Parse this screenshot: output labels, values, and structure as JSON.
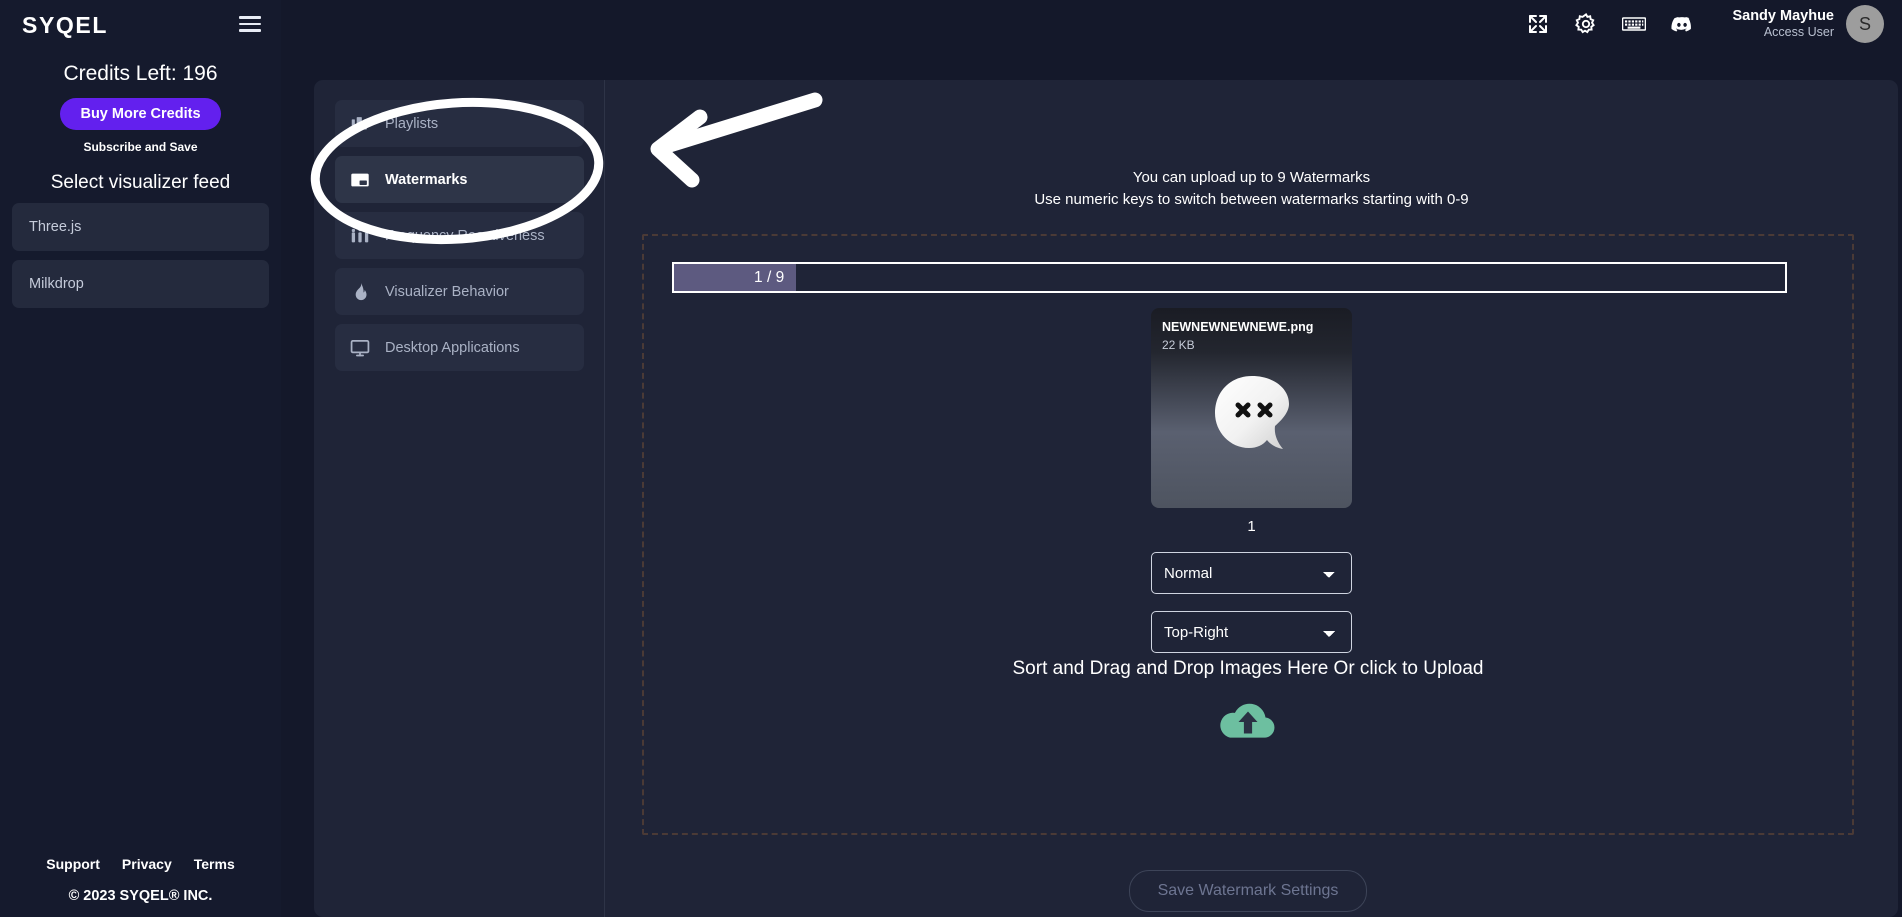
{
  "brand": {
    "logo_text": "SYQEL",
    "menu_icon": "hamburger-menu-icon"
  },
  "sidebar": {
    "credits_label": "Credits Left: 196",
    "buy_credits_label": "Buy More Credits",
    "subscribe_label": "Subscribe and Save",
    "feed_section_title": "Select visualizer feed",
    "feeds": [
      {
        "label": "Three.js"
      },
      {
        "label": "Milkdrop"
      }
    ],
    "footer": {
      "links": [
        "Support",
        "Privacy",
        "Terms"
      ],
      "copyright": "© 2023 SYQEL® INC."
    }
  },
  "topbar": {
    "icons": [
      {
        "name": "fullscreen-expand-icon"
      },
      {
        "name": "gear-icon"
      },
      {
        "name": "keyboard-icon"
      },
      {
        "name": "discord-icon"
      }
    ],
    "user_name": "Sandy Mayhue",
    "user_role": "Access User",
    "avatar_initial": "S"
  },
  "nav": {
    "items": [
      {
        "label": "Playlists",
        "icon": "playlists-bars-icon",
        "active": false
      },
      {
        "label": "Watermarks",
        "icon": "watermark-frame-icon",
        "active": true
      },
      {
        "label": "Frequency Reactiveness",
        "icon": "equalizer-icon",
        "active": false
      },
      {
        "label": "Visualizer Behavior",
        "icon": "flame-icon",
        "active": false
      },
      {
        "label": "Desktop Applications",
        "icon": "monitor-icon",
        "active": false
      }
    ]
  },
  "main": {
    "info_line_1": "You can upload up to 9 Watermarks",
    "info_line_2": "Use numeric keys to switch between watermarks starting with 0-9",
    "progress": {
      "text": "1 / 9",
      "current": 1,
      "max": 9,
      "fill_color": "#5d5a80"
    },
    "watermark": {
      "filename": "NEWNEWNEWNEWE.png",
      "filesize": "22 KB",
      "index_label": "1",
      "thumb_icon": "ghost-blob-icon"
    },
    "blend_mode": {
      "value": "Normal",
      "options": [
        "Normal"
      ]
    },
    "position": {
      "value": "Top-Right",
      "options": [
        "Top-Right"
      ]
    },
    "upload_prompt": "Sort and Drag and Drop Images Here Or click to Upload",
    "upload_icon": "cloud-upload-icon",
    "upload_icon_color": "#6dbfa0",
    "save_button_label": "Save Watermark Settings"
  },
  "annotations": {
    "ellipse": "highlight-ellipse",
    "arrow": "pointer-arrow",
    "color": "#ffffff"
  }
}
